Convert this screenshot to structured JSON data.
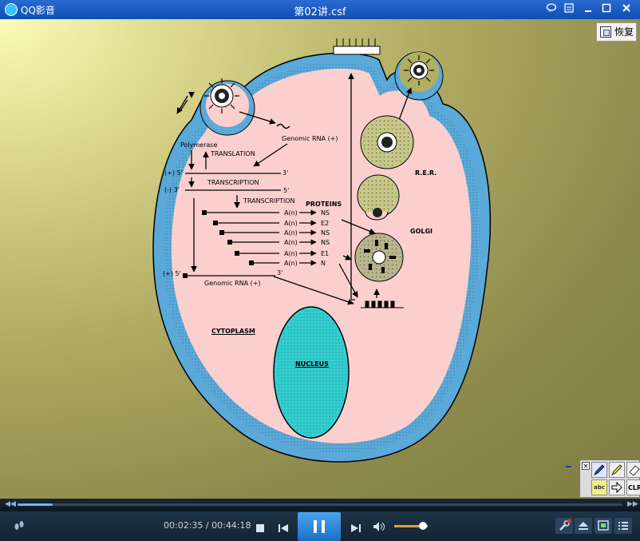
{
  "window": {
    "app_name": "QQ影音",
    "title": "第02讲.csf"
  },
  "video": {
    "restore_label": "恢复",
    "diagram": {
      "polymerase": "Polymerase",
      "translation": "TRANSLATION",
      "genomic_rna_top": "Genomic RNA (+)",
      "strand_plus_5": "(+) 5'",
      "strand_3_top": "3'",
      "transcription_1": "TRANSCRIPTION",
      "strand_minus_3": "(-) 3'",
      "strand_5_mid": "5'",
      "transcription_2": "TRANSCRIPTION",
      "proteins": "PROTEINS",
      "mrnas": [
        {
          "tail": "A(n)",
          "product": "NS"
        },
        {
          "tail": "A(n)",
          "product": "E2"
        },
        {
          "tail": "A(n)",
          "product": "NS"
        },
        {
          "tail": "A(n)",
          "product": "NS"
        },
        {
          "tail": "A(n)",
          "product": "E1"
        },
        {
          "tail": "A(n)",
          "product": "N"
        }
      ],
      "strand_plus_5_bottom": "(+) 5'",
      "strand_3_bottom": "3'",
      "genomic_rna_bottom": "Genomic RNA (+)",
      "rer": "R.E.R.",
      "golgi": "GOLGI",
      "cytoplasm": "CYTOPLASM",
      "nucleus": "NUCLEUS"
    }
  },
  "palette": {
    "close": "×",
    "text_tool": "abc",
    "clear": "CLR"
  },
  "player": {
    "current_time": "00:02:35",
    "separator": " / ",
    "duration": "00:44:18",
    "progress": 0.058,
    "volume": 0.85
  }
}
